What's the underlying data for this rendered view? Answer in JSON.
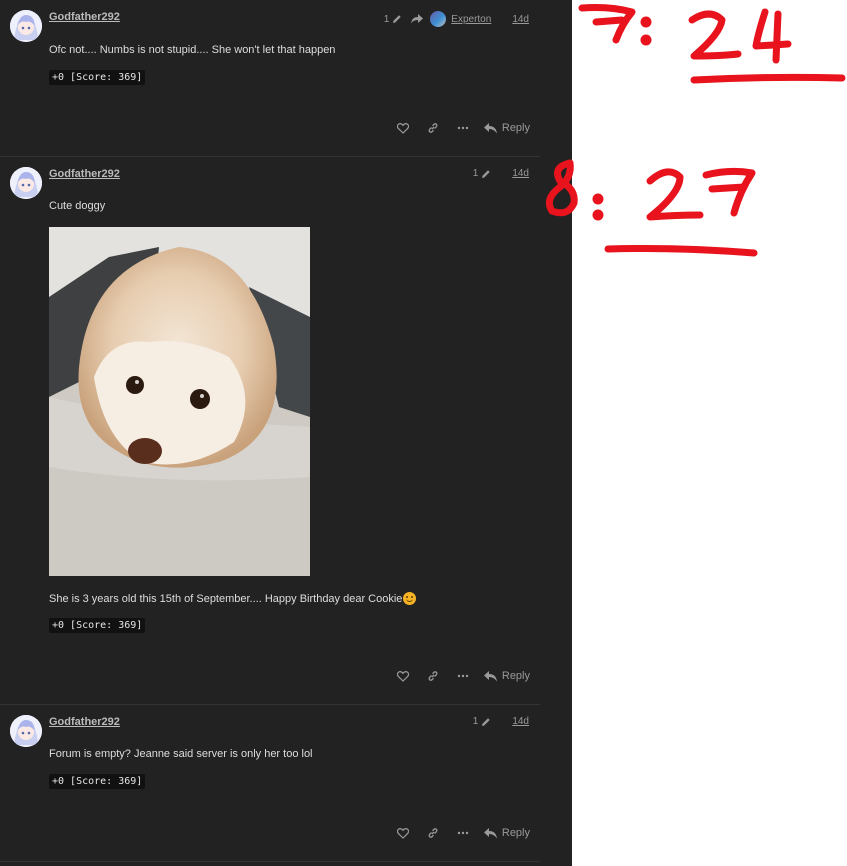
{
  "posts": [
    {
      "username": "Godfather292",
      "edit_count": "1",
      "edited_by": "Experton",
      "age": "14d",
      "text": "Ofc not.... Numbs is not stupid.... She won't let that happen",
      "score": "+0 [Score: 369]",
      "reply_label": "Reply"
    },
    {
      "username": "Godfather292",
      "edit_count": "1",
      "age": "14d",
      "text": "Cute doggy",
      "text_after": "She is 3 years old this 15th of September.... Happy Birthday dear Cookie",
      "score": "+0 [Score: 369]",
      "reply_label": "Reply"
    },
    {
      "username": "Godfather292",
      "edit_count": "1",
      "age": "14d",
      "text": "Forum is empty? Jeanne said server is only her too lol",
      "score": "+0 [Score: 369]",
      "reply_label": "Reply"
    }
  ],
  "annotations": {
    "first": "7: 24",
    "second": "8: 27"
  },
  "colors": {
    "background": "#222222",
    "annotation": "#e8131c"
  },
  "icons": [
    "heart-icon",
    "link-icon",
    "more-icon",
    "reply-icon",
    "pencil-icon",
    "share-arrow-icon",
    "smiling-face-icon"
  ]
}
